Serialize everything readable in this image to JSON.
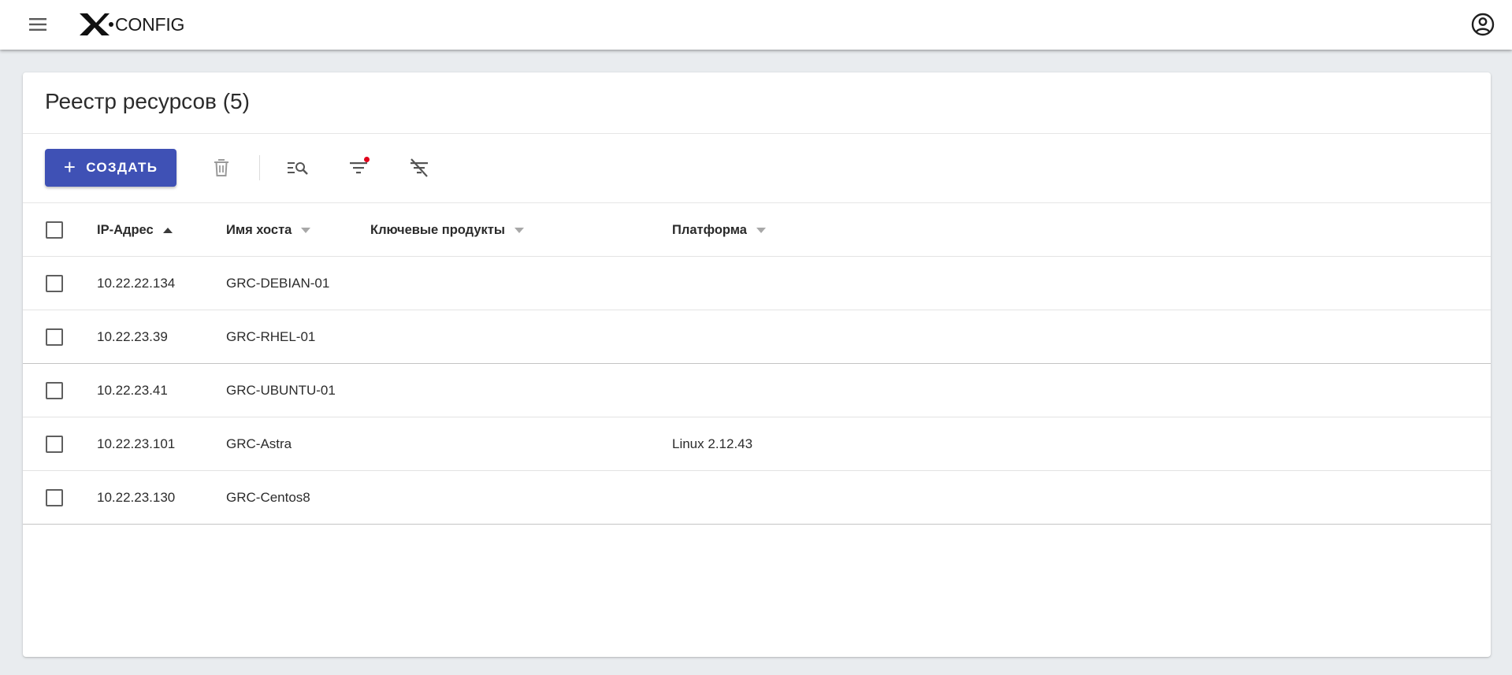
{
  "app": {
    "logo_text": "CONFIG",
    "logo_mark": "X"
  },
  "page": {
    "title": "Реестр ресурсов (5)"
  },
  "toolbar": {
    "create_label": "СОЗДАТЬ",
    "create_icon": "plus-icon",
    "icons": [
      "delete-icon",
      "search-list-icon",
      "filter-icon",
      "clear-filter-icon"
    ],
    "filter_badge_color": "#e0001b"
  },
  "colors": {
    "accent": "#3f51b5",
    "background": "#e9ecef"
  },
  "table": {
    "columns": [
      {
        "label": "IP-Адрес",
        "sort": "asc"
      },
      {
        "label": "Имя хоста",
        "sort": "none"
      },
      {
        "label": "Ключевые продукты",
        "sort": "none"
      },
      {
        "label": "Платформа",
        "sort": "none"
      }
    ],
    "rows": [
      {
        "ip": "10.22.22.134",
        "host": "GRC-DEBIAN-01",
        "products": "",
        "platform": ""
      },
      {
        "ip": "10.22.23.39",
        "host": "GRC-RHEL-01",
        "products": "",
        "platform": ""
      },
      {
        "ip": "10.22.23.41",
        "host": "GRC-UBUNTU-01",
        "products": "",
        "platform": ""
      },
      {
        "ip": "10.22.23.101",
        "host": "GRC-Astra",
        "products": "",
        "platform": "Linux 2.12.43"
      },
      {
        "ip": "10.22.23.130",
        "host": "GRC-Centos8",
        "products": "",
        "platform": ""
      }
    ]
  }
}
